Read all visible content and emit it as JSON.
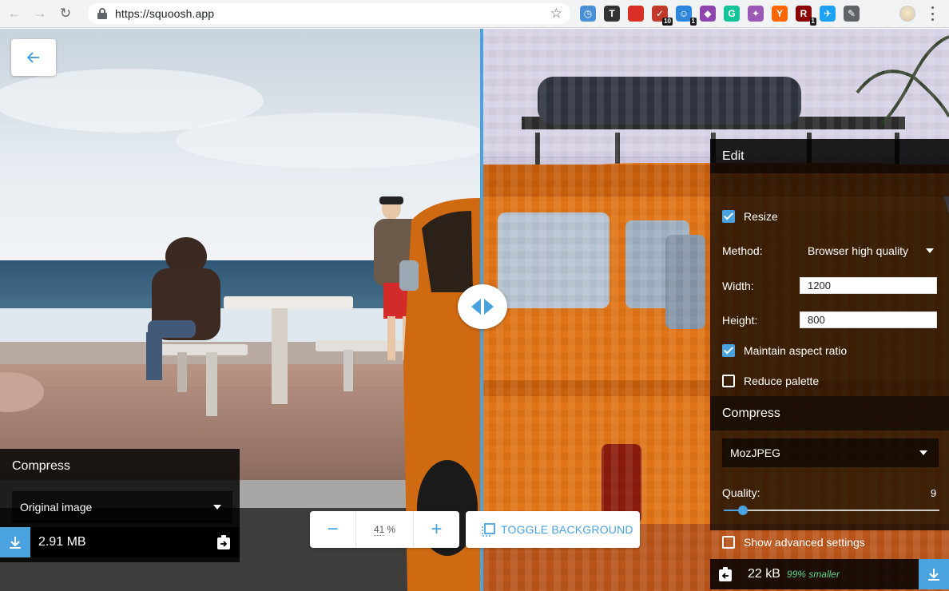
{
  "browser": {
    "url": "https://squoosh.app",
    "extensions": [
      {
        "name": "clock-extension-icon",
        "color": "#4a90d9",
        "glyph": "◷",
        "badge": ""
      },
      {
        "name": "t-extension-icon",
        "color": "#333333",
        "glyph": "T",
        "badge": ""
      },
      {
        "name": "bookmark-extension-icon",
        "color": "#d93025",
        "glyph": "",
        "badge": ""
      },
      {
        "name": "todo-extension-icon",
        "color": "#c0392b",
        "glyph": "✓",
        "badge": "10"
      },
      {
        "name": "robot-extension-icon",
        "color": "#2e86de",
        "glyph": "☺",
        "badge": "1"
      },
      {
        "name": "color-wheel-extension-icon",
        "color": "#8e44ad",
        "glyph": "◆",
        "badge": ""
      },
      {
        "name": "grammarly-extension-icon",
        "color": "#15c39a",
        "glyph": "G",
        "badge": ""
      },
      {
        "name": "unicorn-extension-icon",
        "color": "#9b59b6",
        "glyph": "✦",
        "badge": ""
      },
      {
        "name": "ycombinator-extension-icon",
        "color": "#ff6600",
        "glyph": "Y",
        "badge": ""
      },
      {
        "name": "rocket-extension-icon",
        "color": "#8b0000",
        "glyph": "R",
        "badge": "1"
      },
      {
        "name": "twitter-extension-icon",
        "color": "#1da1f2",
        "glyph": "✈",
        "badge": ""
      },
      {
        "name": "pin-extension-icon",
        "color": "#5f6368",
        "glyph": "✎",
        "badge": ""
      }
    ]
  },
  "left_panel": {
    "title": "Compress",
    "codec": "Original image",
    "size": "2.91 MB"
  },
  "zoom": {
    "minus": "−",
    "value": "41",
    "unit": "%",
    "plus": "+"
  },
  "toggle_background": "TOGGLE BACKGROUND",
  "right_panel": {
    "edit_title": "Edit",
    "resize_label": "Resize",
    "resize_checked": true,
    "method_label": "Method:",
    "method_value": "Browser high quality",
    "width_label": "Width:",
    "width_value": "1200",
    "height_label": "Height:",
    "height_value": "800",
    "aspect_label": "Maintain aspect ratio",
    "aspect_checked": true,
    "palette_label": "Reduce palette",
    "palette_checked": false,
    "compress_title": "Compress",
    "codec": "MozJPEG",
    "quality_label": "Quality:",
    "quality_value": "9",
    "quality_fraction": 0.09,
    "advanced_label": "Show advanced settings",
    "advanced_checked": false,
    "size": "22 kB",
    "saving": "99% smaller"
  },
  "colors": {
    "accent": "#4aa3df",
    "saving": "#5fd38d"
  }
}
